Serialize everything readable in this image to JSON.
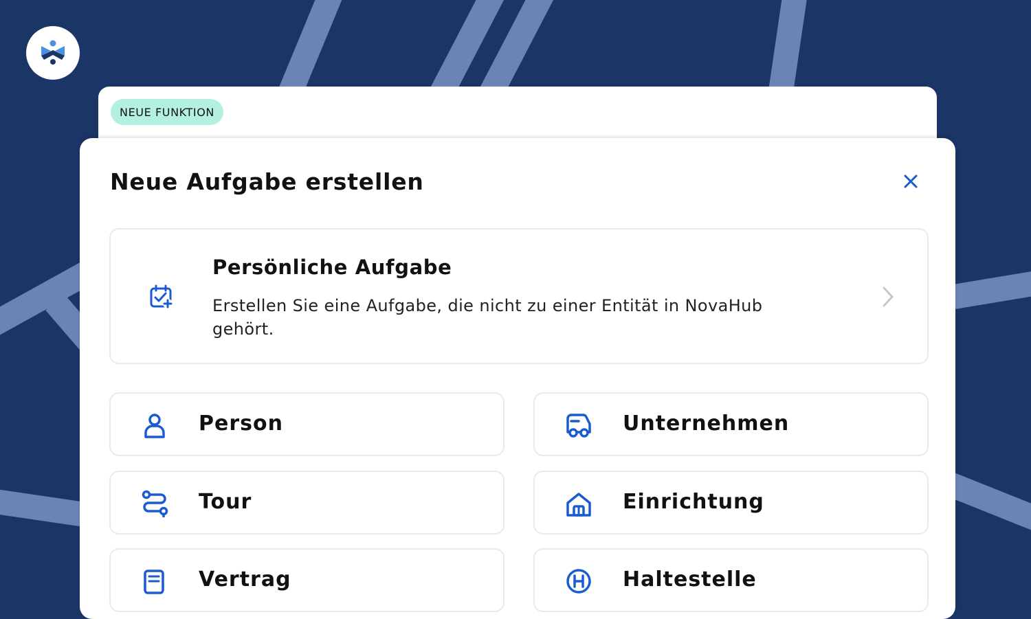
{
  "badge": "NEUE FUNKTION",
  "modal": {
    "title": "Neue Aufgabe erstellen",
    "personal": {
      "title": "Persönliche Aufgabe",
      "description": "Erstellen Sie eine Aufgabe, die nicht zu einer Entität in NovaHub gehört.",
      "icon": "calendar-check-plus-icon"
    },
    "options": [
      {
        "label": "Person",
        "icon": "person-icon"
      },
      {
        "label": "Unternehmen",
        "icon": "vehicle-icon"
      },
      {
        "label": "Tour",
        "icon": "route-icon"
      },
      {
        "label": "Einrichtung",
        "icon": "building-icon"
      },
      {
        "label": "Vertrag",
        "icon": "document-icon"
      },
      {
        "label": "Haltestelle",
        "icon": "bus-stop-icon"
      }
    ]
  },
  "colors": {
    "background": "#1a3566",
    "accent": "#1a5bd1",
    "badge": "#b3f0e2",
    "decor_lines": "#6b84b6"
  }
}
